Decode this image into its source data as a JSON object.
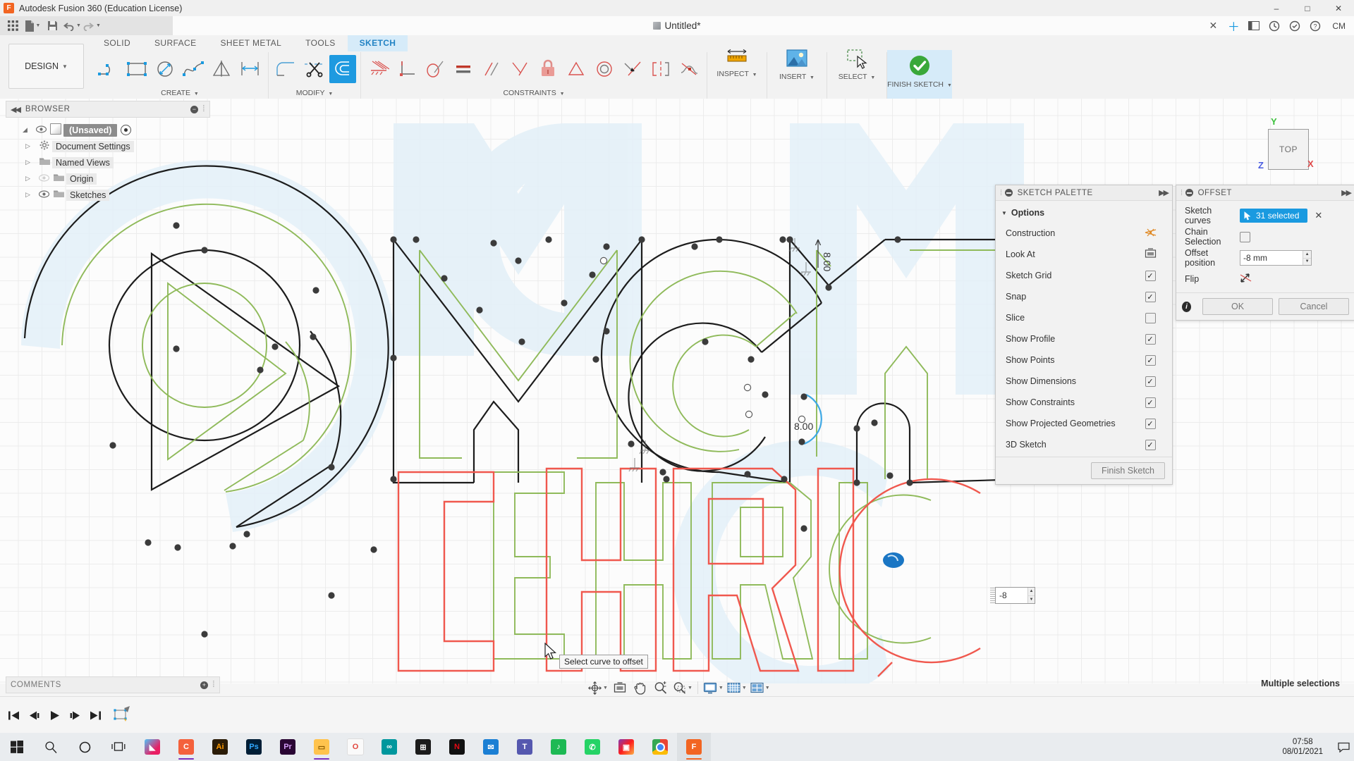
{
  "window": {
    "title": "Autodesk Fusion 360 (Education License)",
    "minimize": "–",
    "maximize": "□",
    "close": "✕"
  },
  "quick_access": {
    "grid_icon": "grid-icon",
    "new_label": "new-file",
    "save_label": "save",
    "undo_label": "undo",
    "redo_label": "redo",
    "document_title": "Untitled*",
    "user_initials": "CM",
    "close_doc": "✕",
    "add_tab": "＋"
  },
  "ribbon": {
    "workspace": "DESIGN",
    "tabs": [
      {
        "label": "SOLID",
        "active": false
      },
      {
        "label": "SURFACE",
        "active": false
      },
      {
        "label": "SHEET METAL",
        "active": false
      },
      {
        "label": "TOOLS",
        "active": false
      },
      {
        "label": "SKETCH",
        "active": true
      }
    ],
    "groups": [
      {
        "label": "CREATE",
        "name": "create-group"
      },
      {
        "label": "MODIFY",
        "name": "modify-group"
      },
      {
        "label": "CONSTRAINTS",
        "name": "constraints-group"
      }
    ],
    "create_tools": [
      "line-icon",
      "rectangle-icon",
      "circle-icon",
      "spline-icon",
      "mirror-icon",
      "dimension-icon"
    ],
    "modify_tools": [
      "fillet-icon",
      "trim-icon",
      "offset-icon"
    ],
    "constraint_tools": [
      "fix-constraint-icon",
      "perpendicular-constraint-icon",
      "tangent-constraint-icon",
      "equal-constraint-icon",
      "parallel-constraint-icon",
      "horizontal-vertical-constraint-icon",
      "fix-lock-icon",
      "midpoint-constraint-icon",
      "concentric-constraint-icon",
      "coincident-constraint-icon",
      "symmetry-constraint-icon",
      "curvature-constraint-icon"
    ],
    "big_buttons": [
      {
        "label": "INSPECT",
        "name": "inspect-button",
        "icon": "measure-icon"
      },
      {
        "label": "INSERT",
        "name": "insert-button",
        "icon": "image-icon"
      },
      {
        "label": "SELECT",
        "name": "select-button",
        "icon": "select-cursor-icon"
      },
      {
        "label": "FINISH SKETCH",
        "name": "finish-sketch-button",
        "icon": "green-check-icon"
      }
    ]
  },
  "browser": {
    "header": "BROWSER",
    "items": [
      {
        "label": "(Unsaved)",
        "icon": "component-cube-icon",
        "root": true,
        "eye": true
      },
      {
        "label": "Document Settings",
        "icon": "gear-icon",
        "root": false
      },
      {
        "label": "Named Views",
        "icon": "folder-icon",
        "root": false
      },
      {
        "label": "Origin",
        "icon": "folder-icon",
        "root": false
      },
      {
        "label": "Sketches",
        "icon": "folder-icon",
        "root": false
      }
    ]
  },
  "view_cube": {
    "face": "TOP",
    "axis_y": "Y",
    "axis_z": "Z",
    "axis_x": "X"
  },
  "sketch_palette": {
    "title": "SKETCH PALETTE",
    "section": "Options",
    "rows": [
      {
        "label": "Construction",
        "control": "icon",
        "icon": "construction-icon",
        "checked": false
      },
      {
        "label": "Look At",
        "control": "icon",
        "icon": "look-at-icon",
        "checked": false
      },
      {
        "label": "Sketch Grid",
        "control": "checkbox",
        "checked": true
      },
      {
        "label": "Snap",
        "control": "checkbox",
        "checked": true
      },
      {
        "label": "Slice",
        "control": "checkbox",
        "checked": false
      },
      {
        "label": "Show Profile",
        "control": "checkbox",
        "checked": true
      },
      {
        "label": "Show Points",
        "control": "checkbox",
        "checked": true
      },
      {
        "label": "Show Dimensions",
        "control": "checkbox",
        "checked": true
      },
      {
        "label": "Show Constraints",
        "control": "checkbox",
        "checked": true
      },
      {
        "label": "Show Projected Geometries",
        "control": "checkbox",
        "checked": true
      },
      {
        "label": "3D Sketch",
        "control": "checkbox",
        "checked": true
      }
    ],
    "finish_button": "Finish Sketch"
  },
  "offset_dialog": {
    "title": "OFFSET",
    "sketch_curves_label": "Sketch curves",
    "sketch_curves_value": "31 selected",
    "clear_selection": "✕",
    "chain_selection_label": "Chain Selection",
    "chain_selection_checked": false,
    "offset_position_label": "Offset position",
    "offset_position_value": "-8 mm",
    "flip_label": "Flip",
    "flip_icon": "flip-icon",
    "ok": "OK",
    "cancel": "Cancel",
    "info_icon": "info-icon"
  },
  "canvas": {
    "tooltip": "Select curve to offset",
    "floating_input_value": "-8",
    "dimension_labels": [
      "8.00",
      "8.00"
    ],
    "status_right": "Multiple selections",
    "accent_selected": "#1a9ae0",
    "profile_fill": "#e3f0f8",
    "offset_green": "#8fba5a",
    "offset_red": "#f05a50",
    "curve_black": "#1c1c1c"
  },
  "comments": {
    "header": "COMMENTS"
  },
  "navbar": {
    "buttons": [
      {
        "name": "orbit-icon",
        "label": "orbit"
      },
      {
        "name": "look-at-icon",
        "label": "look-at"
      },
      {
        "name": "pan-hand-icon",
        "label": "pan"
      },
      {
        "name": "zoom-icon",
        "label": "zoom"
      },
      {
        "name": "zoom-window-icon",
        "label": "zoom-window"
      },
      {
        "name": "display-settings-icon",
        "label": "display-settings"
      },
      {
        "name": "grid-snaps-icon",
        "label": "grid-and-snaps"
      },
      {
        "name": "viewports-icon",
        "label": "viewports"
      }
    ]
  },
  "timeline": {
    "buttons": [
      "go-to-beginning-icon",
      "step-back-icon",
      "play-icon",
      "step-forward-icon",
      "go-to-end-icon"
    ],
    "feature": "sketch-feature-icon"
  },
  "taskbar": {
    "start": "start-icon",
    "search": "search-icon",
    "cortana": "cortana-icon",
    "taskview": "task-view-icon",
    "apps": [
      {
        "name": "paint-3d-icon",
        "color": "#3aa0dd",
        "glyph": "◢"
      },
      {
        "name": "ccleaner-icon",
        "color": "#f4613c",
        "glyph": "C"
      },
      {
        "name": "illustrator-icon",
        "color": "#2b1c07",
        "glyph": "Ai"
      },
      {
        "name": "photoshop-icon",
        "color": "#001e36",
        "glyph": "Ps"
      },
      {
        "name": "premiere-icon",
        "color": "#2a0634",
        "glyph": "Pr"
      },
      {
        "name": "file-explorer-icon",
        "color": "#ffc34d",
        "glyph": "▭"
      },
      {
        "name": "opera-icon",
        "color": "#fafafa",
        "glyph": "O"
      },
      {
        "name": "arduino-icon",
        "color": "#00979d",
        "glyph": "∞"
      },
      {
        "name": "microsoft-store-icon",
        "color": "#1b1b1b",
        "glyph": "⊞"
      },
      {
        "name": "netflix-icon",
        "color": "#111111",
        "glyph": "N"
      },
      {
        "name": "mail-icon",
        "color": "#1b7fd4",
        "glyph": "✉"
      },
      {
        "name": "teams-icon",
        "color": "#5558af",
        "glyph": "T"
      },
      {
        "name": "spotify-icon",
        "color": "#1db954",
        "glyph": "♫"
      },
      {
        "name": "whatsapp-icon",
        "color": "#25d366",
        "glyph": "✆"
      },
      {
        "name": "instagram-icon",
        "color": "#8a2be2",
        "glyph": "▣"
      },
      {
        "name": "chrome-icon",
        "color": "#f4b400",
        "glyph": "●"
      },
      {
        "name": "fusion360-icon",
        "color": "#f26522",
        "glyph": "F"
      }
    ],
    "time": "07:58",
    "date": "08/01/2021",
    "action_center": "notifications-icon"
  }
}
